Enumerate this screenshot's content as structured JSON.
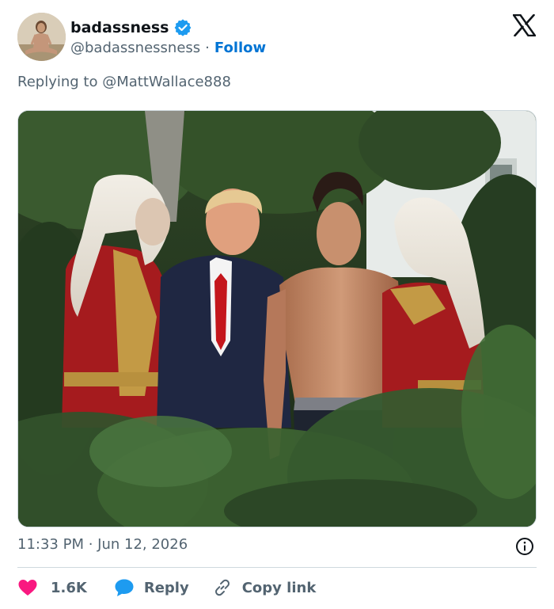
{
  "author": {
    "display_name": "badassness",
    "handle": "@badassnessness",
    "separator": "·",
    "follow_label": "Follow"
  },
  "replying_to": "Replying to @MattWallace888",
  "timestamp": "11:33 PM · Jun 12, 2026",
  "actions": {
    "like_count": "1.6K",
    "reply_label": "Reply",
    "copy_link_label": "Copy link"
  },
  "icons": {
    "verified": "verified-badge-icon",
    "logo": "x-logo-icon",
    "info": "info-icon",
    "like": "heart-icon",
    "reply": "speech-bubble-icon",
    "copy": "link-icon"
  },
  "colors": {
    "link_blue": "#0074d4",
    "verified_blue": "#1d9bf0",
    "like_red": "#f91880",
    "muted_text": "#536471",
    "text": "#0f1419",
    "border": "#cfd9de"
  }
}
